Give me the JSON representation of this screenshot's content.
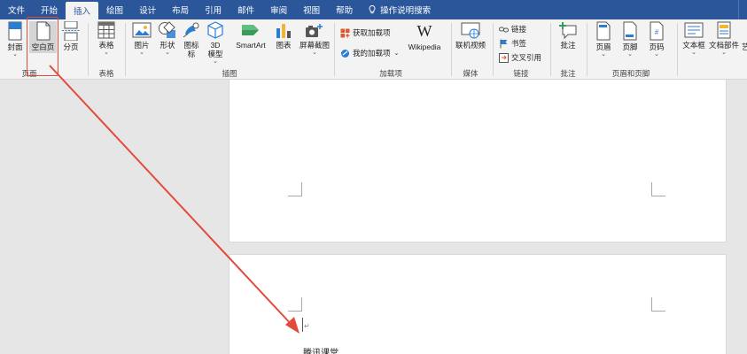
{
  "tabs": [
    "文件",
    "开始",
    "插入",
    "绘图",
    "设计",
    "布局",
    "引用",
    "邮件",
    "审阅",
    "视图",
    "帮助",
    "操作说明搜索"
  ],
  "active_tab": "插入",
  "ribbon": {
    "pages": {
      "label": "页面",
      "cover": "封面",
      "blank": "空白页",
      "break": "分页"
    },
    "tables": {
      "label": "表格",
      "table": "表格"
    },
    "illustrations": {
      "label": "插图",
      "pictures": "图片",
      "shapes": "形状",
      "icons": "图标",
      "model3d": "3D\n模型",
      "model3d_line1": "3D",
      "model3d_line2": "模型",
      "smartart": "SmartArt",
      "chart": "图表",
      "screenshot": "屏幕截图"
    },
    "addins": {
      "label": "加载项",
      "get": "获取加载项",
      "my": "我的加载项",
      "wikipedia": "Wikipedia"
    },
    "media": {
      "label": "媒体",
      "online_video": "联机视频"
    },
    "links": {
      "label": "链接",
      "link": "链接",
      "bookmark": "书签",
      "crossref": "交叉引用"
    },
    "comments": {
      "label": "批注",
      "comment": "批注"
    },
    "header_footer": {
      "label": "页眉和页脚",
      "header": "页眉",
      "footer": "页脚",
      "page_number": "页码"
    },
    "text": {
      "textbox": "文本框",
      "quickparts": "文档部件",
      "wordart_partial": "艺"
    }
  },
  "document": {
    "text": "腾讯课堂"
  },
  "colors": {
    "tab_bar": "#2b579a",
    "ribbon_bg": "#f3f3f3",
    "annotation": "#e24b3b"
  }
}
